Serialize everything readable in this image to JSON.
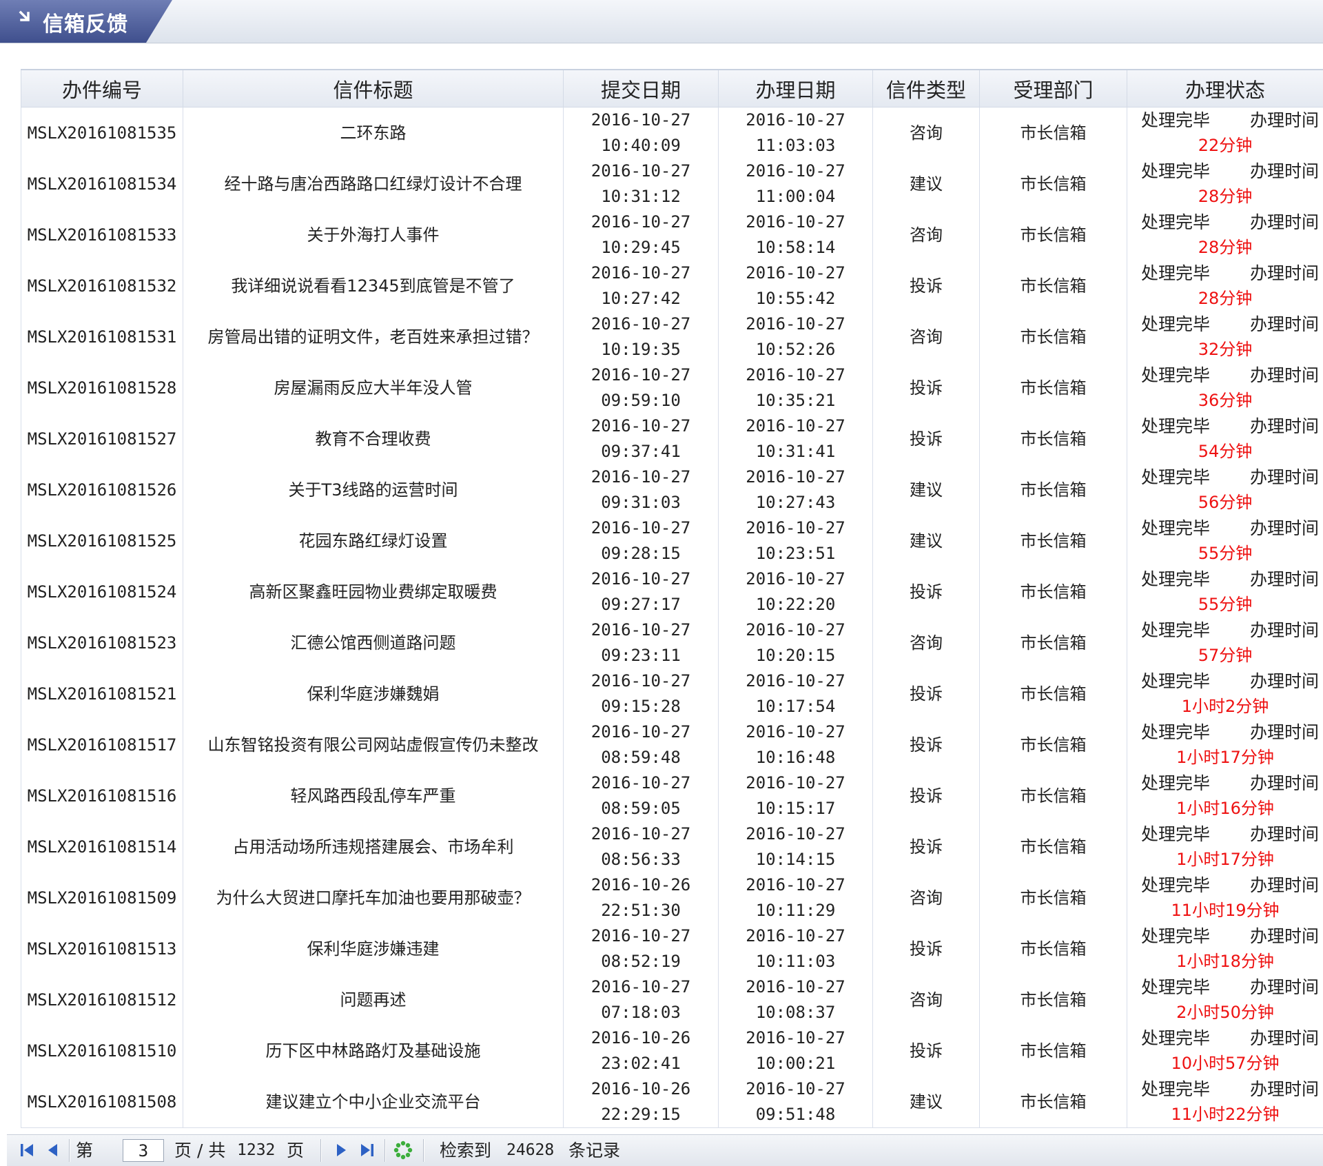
{
  "header": {
    "title": "信箱反馈"
  },
  "table": {
    "columns": [
      "办件编号",
      "信件标题",
      "提交日期",
      "办理日期",
      "信件类型",
      "受理部门",
      "办理状态"
    ],
    "rows": [
      {
        "id": "MSLX20161081535",
        "title": "二环东路",
        "submit_date": "2016-10-27",
        "submit_time": "10:40:09",
        "handle_date": "2016-10-27",
        "handle_time": "11:03:03",
        "type": "咨询",
        "dept": "市长信箱",
        "status": "处理完毕",
        "duration_label": "办理时间",
        "duration": "22分钟"
      },
      {
        "id": "MSLX20161081534",
        "title": "经十路与唐冶西路路口红绿灯设计不合理",
        "submit_date": "2016-10-27",
        "submit_time": "10:31:12",
        "handle_date": "2016-10-27",
        "handle_time": "11:00:04",
        "type": "建议",
        "dept": "市长信箱",
        "status": "处理完毕",
        "duration_label": "办理时间",
        "duration": "28分钟"
      },
      {
        "id": "MSLX20161081533",
        "title": "关于外海打人事件",
        "submit_date": "2016-10-27",
        "submit_time": "10:29:45",
        "handle_date": "2016-10-27",
        "handle_time": "10:58:14",
        "type": "咨询",
        "dept": "市长信箱",
        "status": "处理完毕",
        "duration_label": "办理时间",
        "duration": "28分钟"
      },
      {
        "id": "MSLX20161081532",
        "title": "我详细说说看看12345到底管是不管了",
        "submit_date": "2016-10-27",
        "submit_time": "10:27:42",
        "handle_date": "2016-10-27",
        "handle_time": "10:55:42",
        "type": "投诉",
        "dept": "市长信箱",
        "status": "处理完毕",
        "duration_label": "办理时间",
        "duration": "28分钟"
      },
      {
        "id": "MSLX20161081531",
        "title": "房管局出错的证明文件，老百姓来承担过错？",
        "submit_date": "2016-10-27",
        "submit_time": "10:19:35",
        "handle_date": "2016-10-27",
        "handle_time": "10:52:26",
        "type": "咨询",
        "dept": "市长信箱",
        "status": "处理完毕",
        "duration_label": "办理时间",
        "duration": "32分钟"
      },
      {
        "id": "MSLX20161081528",
        "title": "房屋漏雨反应大半年没人管",
        "submit_date": "2016-10-27",
        "submit_time": "09:59:10",
        "handle_date": "2016-10-27",
        "handle_time": "10:35:21",
        "type": "投诉",
        "dept": "市长信箱",
        "status": "处理完毕",
        "duration_label": "办理时间",
        "duration": "36分钟"
      },
      {
        "id": "MSLX20161081527",
        "title": "教育不合理收费",
        "submit_date": "2016-10-27",
        "submit_time": "09:37:41",
        "handle_date": "2016-10-27",
        "handle_time": "10:31:41",
        "type": "投诉",
        "dept": "市长信箱",
        "status": "处理完毕",
        "duration_label": "办理时间",
        "duration": "54分钟"
      },
      {
        "id": "MSLX20161081526",
        "title": "关于T3线路的运营时间",
        "submit_date": "2016-10-27",
        "submit_time": "09:31:03",
        "handle_date": "2016-10-27",
        "handle_time": "10:27:43",
        "type": "建议",
        "dept": "市长信箱",
        "status": "处理完毕",
        "duration_label": "办理时间",
        "duration": "56分钟"
      },
      {
        "id": "MSLX20161081525",
        "title": "花园东路红绿灯设置",
        "submit_date": "2016-10-27",
        "submit_time": "09:28:15",
        "handle_date": "2016-10-27",
        "handle_time": "10:23:51",
        "type": "建议",
        "dept": "市长信箱",
        "status": "处理完毕",
        "duration_label": "办理时间",
        "duration": "55分钟"
      },
      {
        "id": "MSLX20161081524",
        "title": "高新区聚鑫旺园物业费绑定取暖费",
        "submit_date": "2016-10-27",
        "submit_time": "09:27:17",
        "handle_date": "2016-10-27",
        "handle_time": "10:22:20",
        "type": "投诉",
        "dept": "市长信箱",
        "status": "处理完毕",
        "duration_label": "办理时间",
        "duration": "55分钟"
      },
      {
        "id": "MSLX20161081523",
        "title": "汇德公馆西侧道路问题",
        "submit_date": "2016-10-27",
        "submit_time": "09:23:11",
        "handle_date": "2016-10-27",
        "handle_time": "10:20:15",
        "type": "咨询",
        "dept": "市长信箱",
        "status": "处理完毕",
        "duration_label": "办理时间",
        "duration": "57分钟"
      },
      {
        "id": "MSLX20161081521",
        "title": "保利华庭涉嫌魏娟",
        "submit_date": "2016-10-27",
        "submit_time": "09:15:28",
        "handle_date": "2016-10-27",
        "handle_time": "10:17:54",
        "type": "投诉",
        "dept": "市长信箱",
        "status": "处理完毕",
        "duration_label": "办理时间",
        "duration": "1小时2分钟"
      },
      {
        "id": "MSLX20161081517",
        "title": "山东智铭投资有限公司网站虚假宣传仍未整改",
        "submit_date": "2016-10-27",
        "submit_time": "08:59:48",
        "handle_date": "2016-10-27",
        "handle_time": "10:16:48",
        "type": "投诉",
        "dept": "市长信箱",
        "status": "处理完毕",
        "duration_label": "办理时间",
        "duration": "1小时17分钟"
      },
      {
        "id": "MSLX20161081516",
        "title": "轻风路西段乱停车严重",
        "submit_date": "2016-10-27",
        "submit_time": "08:59:05",
        "handle_date": "2016-10-27",
        "handle_time": "10:15:17",
        "type": "投诉",
        "dept": "市长信箱",
        "status": "处理完毕",
        "duration_label": "办理时间",
        "duration": "1小时16分钟"
      },
      {
        "id": "MSLX20161081514",
        "title": "占用活动场所违规搭建展会、市场牟利",
        "submit_date": "2016-10-27",
        "submit_time": "08:56:33",
        "handle_date": "2016-10-27",
        "handle_time": "10:14:15",
        "type": "投诉",
        "dept": "市长信箱",
        "status": "处理完毕",
        "duration_label": "办理时间",
        "duration": "1小时17分钟"
      },
      {
        "id": "MSLX20161081509",
        "title": "为什么大贸进口摩托车加油也要用那破壶？",
        "submit_date": "2016-10-26",
        "submit_time": "22:51:30",
        "handle_date": "2016-10-27",
        "handle_time": "10:11:29",
        "type": "咨询",
        "dept": "市长信箱",
        "status": "处理完毕",
        "duration_label": "办理时间",
        "duration": "11小时19分钟"
      },
      {
        "id": "MSLX20161081513",
        "title": "保利华庭涉嫌违建",
        "submit_date": "2016-10-27",
        "submit_time": "08:52:19",
        "handle_date": "2016-10-27",
        "handle_time": "10:11:03",
        "type": "投诉",
        "dept": "市长信箱",
        "status": "处理完毕",
        "duration_label": "办理时间",
        "duration": "1小时18分钟"
      },
      {
        "id": "MSLX20161081512",
        "title": "问题再述",
        "submit_date": "2016-10-27",
        "submit_time": "07:18:03",
        "handle_date": "2016-10-27",
        "handle_time": "10:08:37",
        "type": "咨询",
        "dept": "市长信箱",
        "status": "处理完毕",
        "duration_label": "办理时间",
        "duration": "2小时50分钟"
      },
      {
        "id": "MSLX20161081510",
        "title": "历下区中林路路灯及基础设施",
        "submit_date": "2016-10-26",
        "submit_time": "23:02:41",
        "handle_date": "2016-10-27",
        "handle_time": "10:00:21",
        "type": "投诉",
        "dept": "市长信箱",
        "status": "处理完毕",
        "duration_label": "办理时间",
        "duration": "10小时57分钟"
      },
      {
        "id": "MSLX20161081508",
        "title": "建议建立个中小企业交流平台",
        "submit_date": "2016-10-26",
        "submit_time": "22:29:15",
        "handle_date": "2016-10-27",
        "handle_time": "09:51:48",
        "type": "建议",
        "dept": "市长信箱",
        "status": "处理完毕",
        "duration_label": "办理时间",
        "duration": "11小时22分钟"
      }
    ]
  },
  "pager": {
    "page_prefix": "第",
    "current_page": "3",
    "page_mid": "页 / 共",
    "total_pages": "1232",
    "page_suffix": "页",
    "found_prefix": "检索到",
    "total_records": "24628",
    "found_suffix": "条记录",
    "icons": [
      "first-page-icon",
      "prev-page-icon",
      "next-page-icon",
      "last-page-icon",
      "refresh-icon"
    ]
  },
  "colors": {
    "title_tab": "#4a5a98",
    "duration_text": "#ee1111",
    "pager_icon": "#2d61c4",
    "refresh_icon": "#3cae3c"
  }
}
